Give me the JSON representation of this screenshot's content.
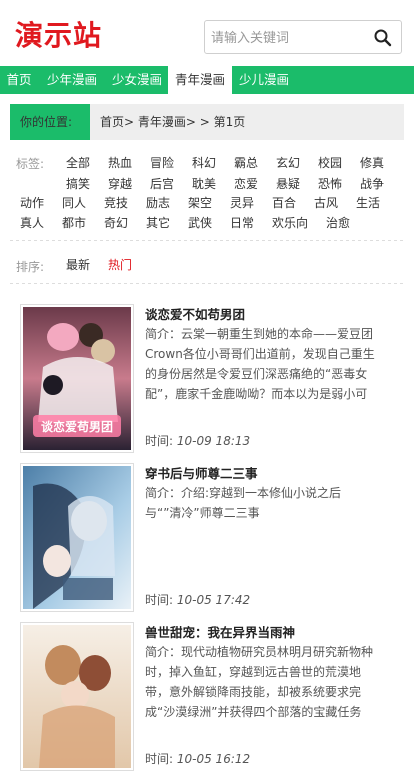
{
  "site": {
    "logo": "演示站"
  },
  "search": {
    "placeholder": "请输入关键词",
    "icon": "search-icon"
  },
  "nav": [
    {
      "label": "首页",
      "active": false
    },
    {
      "label": "少年漫画",
      "active": false
    },
    {
      "label": "少女漫画",
      "active": false
    },
    {
      "label": "青年漫画",
      "active": true
    },
    {
      "label": "少儿漫画",
      "active": false
    }
  ],
  "breadcrumb": {
    "label": "你的位置:",
    "path": "首页> 青年漫画> > 第1页"
  },
  "tags": {
    "title": "标签:",
    "items": [
      "全部",
      "热血",
      "冒险",
      "科幻",
      "霸总",
      "玄幻",
      "校园",
      "修真",
      "搞笑",
      "穿越",
      "后宫",
      "耽美",
      "恋爱",
      "悬疑",
      "恐怖",
      "战争",
      "动作",
      "同人",
      "竞技",
      "励志",
      "架空",
      "灵异",
      "百合",
      "古风",
      "生活",
      "真人",
      "都市",
      "奇幻",
      "其它",
      "武侠",
      "日常",
      "欢乐向",
      "治愈"
    ]
  },
  "sort": {
    "title": "排序:",
    "options": [
      "最新",
      "热门"
    ],
    "active": "热门"
  },
  "comics": [
    {
      "title": "谈恋爱不如苟男团",
      "desc": "简介：云棠一朝重生到她的本命——爱豆团Crown各位小哥哥们出道前，发现自己重生的身份居然是令爱豆们深恶痛绝的“恶毒女配”，鹿家千金鹿呦呦？而本以为是弱小可怜的……",
      "time_label": "时间:",
      "time": "10-09 18:13",
      "cover_text": "谈恋爱苟男团"
    },
    {
      "title": "穿书后与师尊二三事",
      "desc": "简介：介绍:穿越到一本修仙小说之后与“”清冷”师尊二三事",
      "time_label": "时间:",
      "time": "10-05 17:42",
      "cover_text": ""
    },
    {
      "title": "兽世甜宠：我在异界当雨神",
      "desc": "简介：现代动植物研究员林明月研究新物种时，掉入鱼缸，穿越到远古兽世的荒漠地带，意外解锁降雨技能，却被系统要求完成“沙漠绿洲”并获得四个部落的宝藏任务才……",
      "time_label": "时间:",
      "time": "10-05 16:12",
      "cover_text": ""
    }
  ],
  "colors": {
    "brand": "#1bbc6a",
    "logo": "#e0191f",
    "hot": "#e0191f"
  }
}
